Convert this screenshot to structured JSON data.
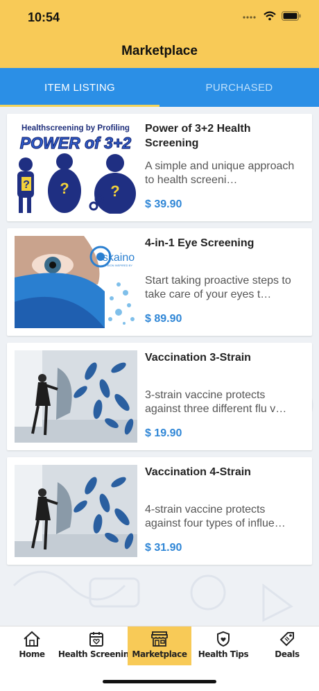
{
  "status_bar": {
    "time": "10:54"
  },
  "header": {
    "title": "Marketplace"
  },
  "tabs": [
    {
      "label": "ITEM LISTING",
      "active": true
    },
    {
      "label": "PURCHASED",
      "active": false
    }
  ],
  "items": [
    {
      "name": "Power of 3+2 Health Screening",
      "description": "A simple and unique approach to health screeni…",
      "price": "$ 39.90",
      "image_text_top": "Healthscreening by Profiling",
      "image_text_big": "POWER of 3+2"
    },
    {
      "name": "4-in-1 Eye Screening",
      "description": "Start taking proactive steps to take care of your eyes t…",
      "price": "$ 89.90",
      "image_brand": "skaino",
      "image_tagline": "VISION INSPIRED BY"
    },
    {
      "name": "Vaccination 3-Strain",
      "description": "3-strain vaccine protects against three different flu v…",
      "price": "$ 19.90"
    },
    {
      "name": "Vaccination 4-Strain",
      "description": "4-strain vaccine protects against four types of influe…",
      "price": "$ 31.90"
    }
  ],
  "bottom_nav": [
    {
      "label": "Home",
      "icon": "home-icon",
      "active": false
    },
    {
      "label": "Health Screening",
      "icon": "calendar-heart-icon",
      "active": false
    },
    {
      "label": "Marketplace",
      "icon": "store-icon",
      "active": true
    },
    {
      "label": "Health Tips",
      "icon": "heart-shield-icon",
      "active": false
    },
    {
      "label": "Deals",
      "icon": "tag-icon",
      "active": false
    }
  ],
  "colors": {
    "header": "#f8ca57",
    "tabs": "#2b8fe6",
    "price": "#2f86d6",
    "tab_indicator": "#f2d35a"
  }
}
